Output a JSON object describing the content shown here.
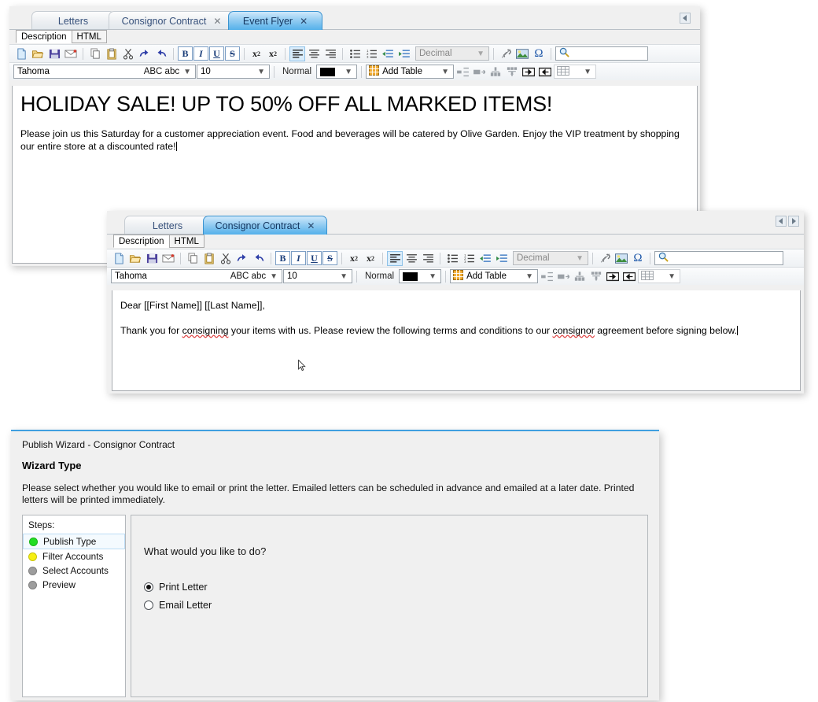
{
  "window_flyer": {
    "tabs": [
      {
        "label": "Letters",
        "closable": false,
        "active": false
      },
      {
        "label": "Consignor Contract",
        "closable": true,
        "active": false
      },
      {
        "label": "Event Flyer",
        "closable": true,
        "active": true
      }
    ],
    "subtabs": [
      {
        "label": "Description",
        "selected": true
      },
      {
        "label": "HTML",
        "selected": false
      }
    ],
    "toolbar": {
      "font_family": "Tahoma",
      "font_preview": "ABC abc",
      "font_size": "10",
      "style_label": "Normal",
      "color_value": "#000000",
      "list_style": "Decimal",
      "table_button": "Add Table",
      "search_value": "",
      "icons": [
        "new-document-icon",
        "open-folder-icon",
        "save-icon",
        "email-icon",
        "copy-icon",
        "paste-icon",
        "cut-icon",
        "undo-icon",
        "redo-icon",
        "bold-icon",
        "italic-icon",
        "underline-icon",
        "strikethrough-icon",
        "subscript-icon",
        "superscript-icon",
        "align-left-icon",
        "align-center-icon",
        "align-right-icon",
        "bullet-list-icon",
        "numbered-list-icon",
        "decrease-indent-icon",
        "increase-indent-icon",
        "unlink-icon",
        "insert-image-icon",
        "special-character-icon",
        "search-icon"
      ]
    },
    "content": {
      "headline": "HOLIDAY SALE! UP TO 50% OFF ALL MARKED ITEMS!",
      "paragraph": "Please join us this Saturday for a customer appreciation event. Food and beverages will be catered by Olive Garden. Enjoy the VIP treatment by shopping our entire store at a discounted rate!"
    },
    "nav": {
      "left_arrow": "◀"
    }
  },
  "window_contract": {
    "tabs": [
      {
        "label": "Letters",
        "closable": false,
        "active": false
      },
      {
        "label": "Consignor Contract",
        "closable": true,
        "active": true
      }
    ],
    "subtabs": [
      {
        "label": "Description",
        "selected": true
      },
      {
        "label": "HTML",
        "selected": false
      }
    ],
    "toolbar": {
      "font_family": "Tahoma",
      "font_preview": "ABC abc",
      "font_size": "10",
      "style_label": "Normal",
      "color_value": "#000000",
      "list_style": "Decimal",
      "table_button": "Add Table",
      "search_value": ""
    },
    "content": {
      "greeting": "Dear [[First Name]] [[Last Name]],",
      "body_pre": "Thank you for ",
      "body_sp1": "consigning",
      "body_mid": " your items with us. Please review the following terms and conditions to our ",
      "body_sp2": "consignor",
      "body_post": " agreement before signing below."
    },
    "nav": {
      "left_arrow": "◀",
      "right_arrow": "▶"
    }
  },
  "wizard": {
    "title": "Publish Wizard - Consignor Contract",
    "heading": "Wizard Type",
    "description": "Please select whether you would like to email or print the letter.  Emailed letters can be scheduled in advance and emailed at a later date.  Printed letters will be printed immediately.",
    "steps_label": "Steps:",
    "steps": [
      {
        "label": "Publish Type",
        "color": "#22dd22",
        "selected": true
      },
      {
        "label": "Filter Accounts",
        "color": "#f6ef12",
        "selected": false
      },
      {
        "label": "Select Accounts",
        "color": "#9d9d9d",
        "selected": false
      },
      {
        "label": "Preview",
        "color": "#9d9d9d",
        "selected": false
      }
    ],
    "question": "What would you like to do?",
    "options": [
      {
        "label": "Print Letter",
        "checked": true
      },
      {
        "label": "Email Letter",
        "checked": false
      }
    ]
  }
}
